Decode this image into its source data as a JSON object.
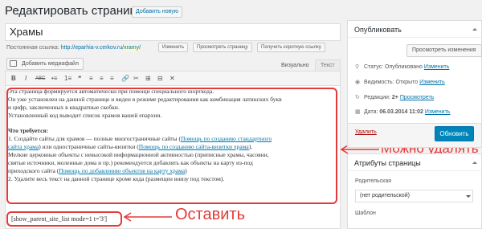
{
  "header": {
    "title": "Редактировать страницу",
    "add_new": "Добавить новую"
  },
  "post": {
    "title": "Храмы"
  },
  "permalink": {
    "label": "Постоянная ссылка:",
    "url_base": "http://eparhia-v.cerkov.ru/",
    "slug": "xramy",
    "url_end": "/",
    "buttons": [
      "Изменить",
      "Просмотреть страницу",
      "Получить короткую ссылку"
    ]
  },
  "editor": {
    "add_media": "Добавить медиафайл",
    "tabs": [
      "Визуально",
      "Текст"
    ],
    "toolbar": [
      "B",
      "I",
      "ABC",
      "•≡",
      "1≡",
      "❝",
      "≡",
      "≡",
      "≡",
      "🔗",
      "✂",
      "⊞",
      "⊟",
      "✕"
    ],
    "content": {
      "p1": "Эта страница формируется автоматически при помощи специального шорткода.",
      "p2": "Он уже установлен на данной странице и виден в режиме редактирования как комбинация латинских букв",
      "p2b": "и цифр, заключенных в квадратные скобки.",
      "p3": "Установленный код выводит  список храмов вашей епархии.",
      "heading": "Что требуется:",
      "i1_pre": "1. Создайте сайты для храмов — полные многостраничные сайты (",
      "i1_link": "Помощь по созданию стандартного",
      "i1_link2": "сайта храма",
      "i1_mid": ") или одностраничные сайты-визитки (",
      "i1_link3": "Помощь по созданию сайта-визитки храма",
      "i1_end": ").",
      "i2": "Мелкие церковные объекты с невысокой информационной активностью (приписные храмы, часовни,",
      "i2b": "святые источники, моленные дома и пр.) рекомендуется добавлять как объекты на карту из-под",
      "i2c_pre": "приходского сайта (",
      "i2c_link": "Помощь по добавлению объектов на карту храма",
      "i2c_end": ")",
      "i3": "2. Удалите весь текст на данной странице кроме кода (размещен внизу под текстом).",
      "shortcode": "[show_parent_site_list mode=1 t='3']"
    }
  },
  "annotations": {
    "deletable": "Можно удалять",
    "keep": "Оставить"
  },
  "publish": {
    "title": "Опубликовать",
    "preview": "Просмотреть изменения",
    "status_label": "Статус:",
    "status_value": "Опубликовано",
    "visibility_label": "Видимость:",
    "visibility_value": "Открыто",
    "revisions_label": "Редакции:",
    "revisions_value": "2+",
    "revisions_link": "Просмотреть",
    "date_label": "Дата:",
    "date_value": "06.03.2014 11:02",
    "edit_link": "Изменить",
    "delete": "Удалить",
    "update": "Обновить"
  },
  "attributes": {
    "title": "Атрибуты страницы",
    "parent_label": "Родительская",
    "parent_value": "(нет родительской)",
    "template_label": "Шаблон"
  },
  "colors": {
    "accent": "#0085ba",
    "annotation": "#e43a3a",
    "link": "#0073aa"
  }
}
